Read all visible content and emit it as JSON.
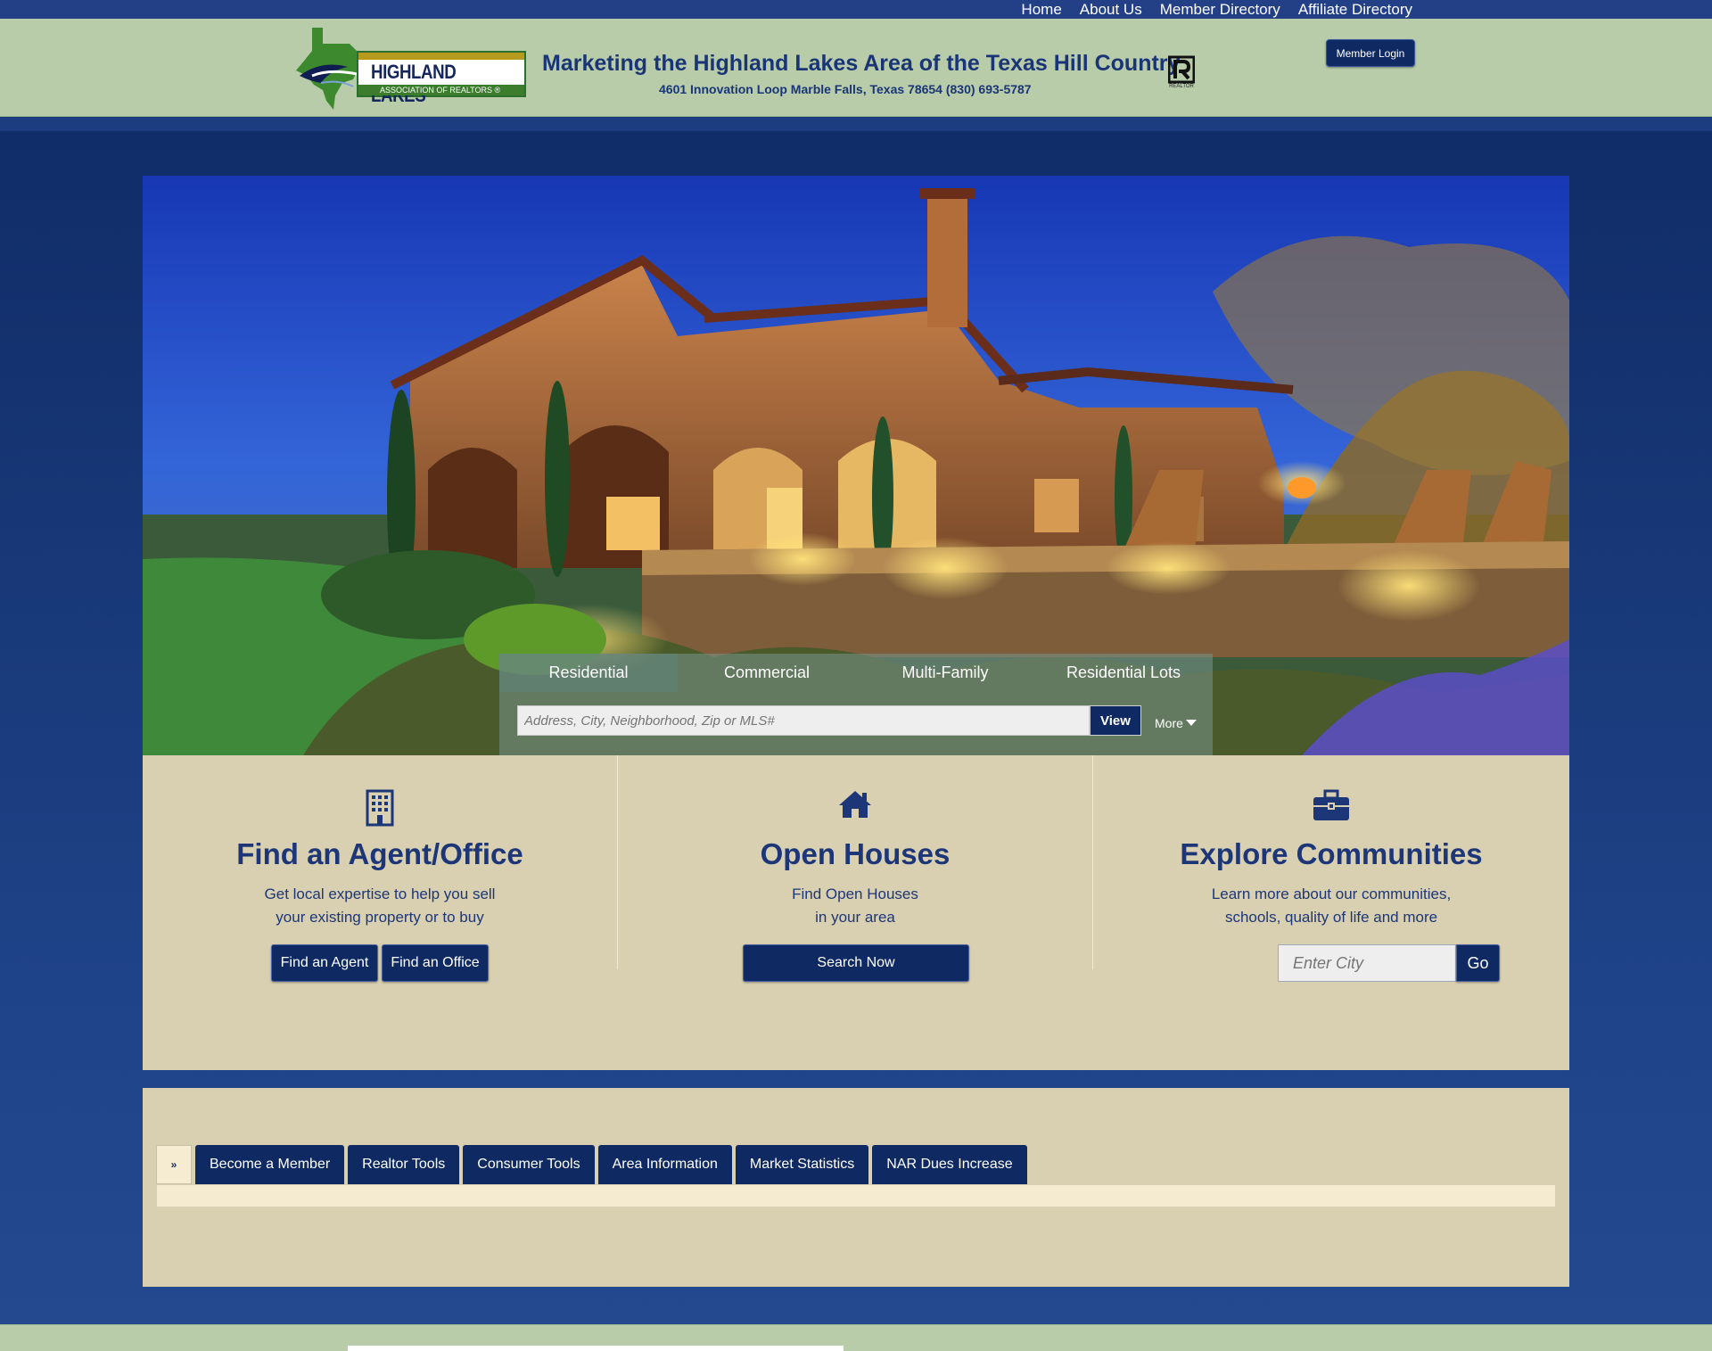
{
  "nav": {
    "links": [
      "Home",
      "About Us",
      "Member Directory",
      "Affiliate Directory"
    ]
  },
  "header": {
    "logo_title": "HIGHLAND LAKES",
    "logo_subtitle": "ASSOCIATION OF REALTORS ®",
    "tagline": "Marketing the Highland Lakes Area of the Texas Hill Country",
    "address": "4601 Innovation Loop Marble Falls, Texas 78654 (830) 693-5787",
    "realtor_mark": "REALTOR",
    "member_login": "Member Login"
  },
  "search": {
    "tabs": [
      "Residential",
      "Commercial",
      "Multi-Family",
      "Residential Lots"
    ],
    "active_tab": "Residential",
    "placeholder": "Address, City, Neighborhood, Zip or MLS#",
    "view_label": "View",
    "more_label": "More"
  },
  "features": {
    "agent": {
      "title": "Find an Agent/Office",
      "desc_line1": "Get local expertise to help you sell",
      "desc_line2": "your existing property or to buy",
      "agent_btn": "Find an Agent",
      "office_btn": "Find an Office",
      "icon": "building-icon"
    },
    "open_houses": {
      "title": "Open Houses",
      "desc_line1": "Find Open Houses",
      "desc_line2": "in your area",
      "search_btn": "Search Now",
      "icon": "home-icon"
    },
    "communities": {
      "title": "Explore Communities",
      "desc_line1": "Learn more about our communities,",
      "desc_line2": "schools, quality of life and more",
      "city_placeholder": "Enter City",
      "go_btn": "Go",
      "icon": "briefcase-icon"
    }
  },
  "info_tabs": {
    "toggle": "»",
    "items": [
      "Become a Member",
      "Realtor Tools",
      "Consumer Tools",
      "Area Information",
      "Market Statistics",
      "NAR Dues Increase"
    ]
  },
  "colors": {
    "navy": "#0f2a63",
    "header_green": "#b8ccaa",
    "panel_tan": "#d8d0b0",
    "text_blue": "#1d3677"
  }
}
